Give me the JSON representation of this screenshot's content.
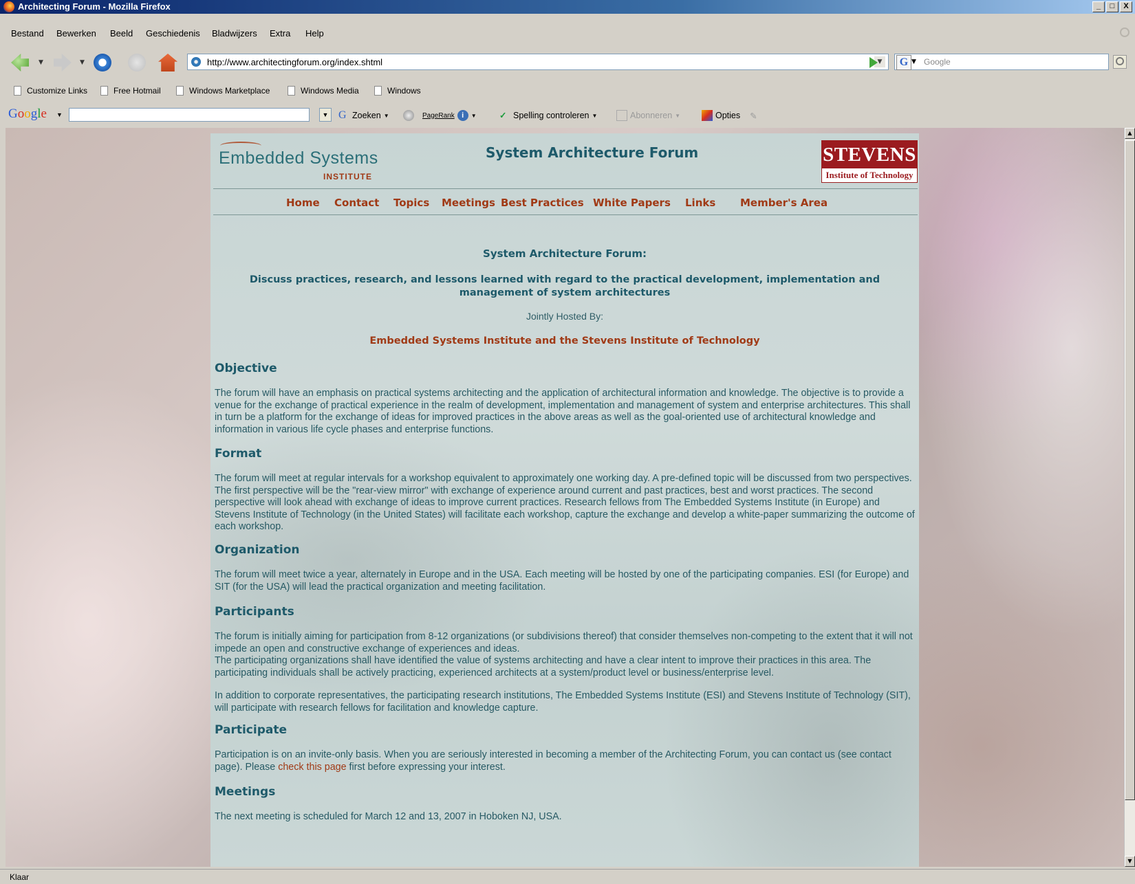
{
  "window": {
    "title": "Architecting Forum - Mozilla Firefox",
    "btn_min": "_",
    "btn_max": "□",
    "btn_close": "X"
  },
  "menu": [
    "Bestand",
    "Bewerken",
    "Beeld",
    "Geschiedenis",
    "Bladwijzers",
    "Extra",
    "Help"
  ],
  "nav": {
    "url": "http://www.architectingforum.org/index.shtml",
    "search_engine_glyph": "G",
    "search_placeholder": "Google"
  },
  "bookmarks": [
    "Customize Links",
    "Free Hotmail",
    "Windows Marketplace",
    "Windows Media",
    "Windows"
  ],
  "google_toolbar": {
    "logo": [
      "G",
      "o",
      "o",
      "g",
      "l",
      "e"
    ],
    "search_label": "Zoeken",
    "pagerank_label": "PageRank",
    "spell_label": "Spelling controleren",
    "subscribe_label": "Abonneren",
    "options_label": "Opties"
  },
  "page": {
    "logo_name": "Embedded Systems",
    "logo_sub": "INSTITUTE",
    "title": "System Architecture Forum",
    "stevens_top": "STEVENS",
    "stevens_bottom": "Institute of Technology",
    "menu": [
      "Home",
      "Contact",
      "Topics",
      "Meetings",
      "Best Practices",
      "White Papers",
      "Links",
      "Member's Area"
    ],
    "intro_title": "System Architecture Forum:",
    "intro_sub": "Discuss practices, research, and lessons learned with regard to the practical development, implementation and management of system architectures",
    "hosted_by": "Jointly Hosted By:",
    "hosts": "Embedded Systems Institute and the Stevens Institute of Technology",
    "sections": {
      "objective": {
        "heading": "Objective",
        "text": "The forum will have an emphasis on practical systems architecting and the application of architectural information and knowledge. The objective is to provide a venue for the exchange of practical experience in the realm of development, implementation and management of system and enterprise architectures. This shall in turn be a platform for the exchange of ideas for improved practices in the above areas as well as the goal-oriented use of architectural knowledge and information in various life cycle phases and enterprise functions."
      },
      "format": {
        "heading": "Format",
        "text": "The forum will meet at regular intervals for a workshop equivalent to approximately one working day. A pre-defined topic will be discussed from two perspectives. The first perspective will be the \"rear-view mirror\" with exchange of experience around current and past practices, best and worst practices. The second perspective will look ahead with exchange of ideas to improve current practices. Research fellows from The Embedded Systems Institute (in Europe) and Stevens Institute of Technology (in the United States) will facilitate each workshop, capture the exchange and develop a white-paper summarizing the outcome of each workshop."
      },
      "organization": {
        "heading": "Organization",
        "text": "The forum will meet twice a year, alternately in Europe and in the USA. Each meeting will be hosted by one of the participating companies. ESI (for Europe) and SIT (for the USA) will lead the practical organization and meeting facilitation."
      },
      "participants": {
        "heading": "Participants",
        "text1": "The forum is initially aiming for participation from 8-12 organizations (or subdivisions thereof) that consider themselves non-competing to the extent that it will not impede an open and constructive exchange of experiences and ideas.",
        "text2": "The participating organizations shall have identified the value of systems architecting and have a clear intent to improve their practices in this area. The participating individuals shall be actively practicing, experienced architects at a system/product level or business/enterprise level.",
        "text3": "In addition to corporate representatives, the participating research institutions, The Embedded Systems Institute (ESI) and Stevens Institute of Technology (SIT), will participate with research fellows for facilitation and knowledge capture."
      },
      "participate": {
        "heading": "Participate",
        "text_before": "Participation is on an invite-only basis. When you are seriously interested in becoming a member of the Architecting Forum, you can contact us (see contact page). Please ",
        "link": "check this page",
        "text_after": " first before expressing your interest."
      },
      "meetings": {
        "heading": "Meetings",
        "text": "The next meeting is scheduled for March 12 and 13, 2007 in Hoboken NJ, USA."
      }
    }
  },
  "status": "Klaar"
}
